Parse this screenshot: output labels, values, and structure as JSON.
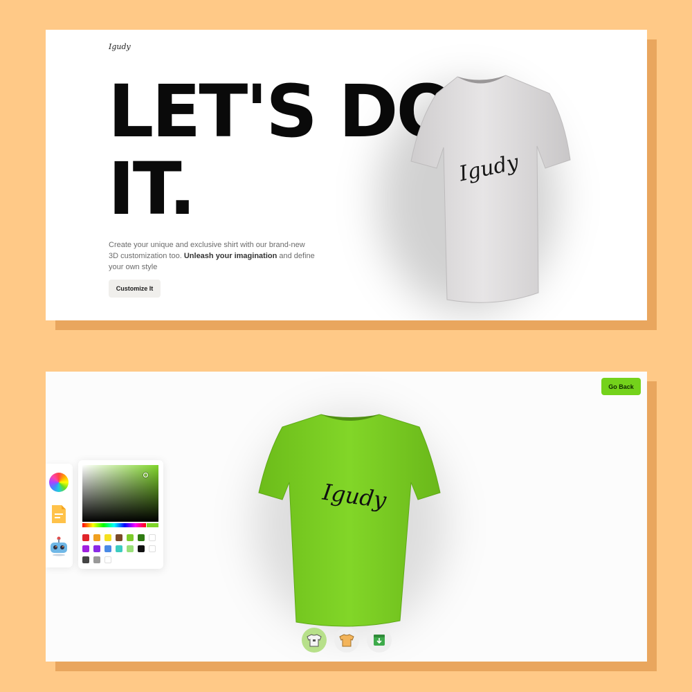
{
  "top_card": {
    "logo_text": "Igudy",
    "headline": "LET'S DO IT.",
    "description_start": "Create your unique and exclusive shirt with our brand-new 3D customization too. ",
    "description_bold": "Unleash your imagination",
    "description_end": " and define your own style",
    "customize_button": "Customize It",
    "shirt_print": "Igudy",
    "shirt_color": "#E4E2E3"
  },
  "bottom_card": {
    "go_back_button": "Go Back",
    "shirt_print": "Igudy",
    "shirt_color": "#7ACF22",
    "tools": [
      {
        "icon": "color-wheel-icon"
      },
      {
        "icon": "file-icon"
      },
      {
        "icon": "ai-robot-icon"
      }
    ],
    "picker": {
      "selected_color": "#7FD42A",
      "swatches": [
        "#E0242A",
        "#F0A020",
        "#F5E020",
        "#7A4A2A",
        "#7CCC2A",
        "#2E7A12",
        "#ffffff",
        "#A020E0",
        "#8A2AE6",
        "#4A8AE6",
        "#3CCCC0",
        "#9AE07A",
        "#111111",
        "#ffffff",
        "#444444",
        "#999999",
        "#ffffff"
      ]
    },
    "bottom_buttons": [
      {
        "icon": "shirt-logo-icon",
        "active": true
      },
      {
        "icon": "shirt-full-icon",
        "active": false
      },
      {
        "icon": "download-icon",
        "active": false
      }
    ]
  }
}
